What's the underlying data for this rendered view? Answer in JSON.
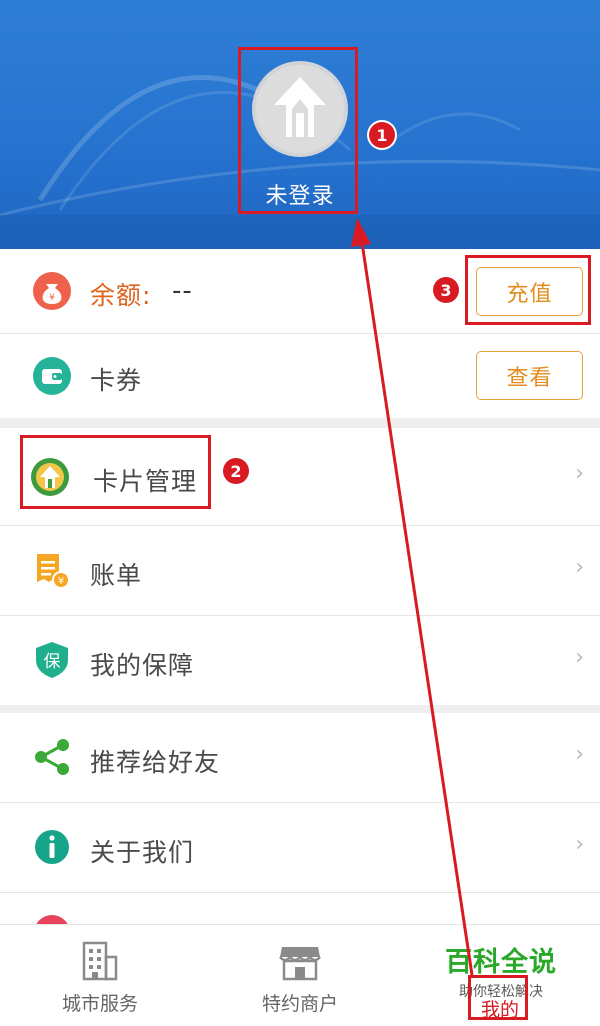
{
  "header": {
    "login_status": "未登录"
  },
  "balance": {
    "label": "余额:",
    "value": "--",
    "recharge_button": "充值"
  },
  "coupon": {
    "label": "卡券",
    "view_button": "查看"
  },
  "menu": {
    "card_management": "卡片管理",
    "bill": "账单",
    "my_protection": "我的保障",
    "recommend": "推荐给好友",
    "about_us": "关于我们"
  },
  "bottom_nav": {
    "items": [
      {
        "label": "城市服务",
        "icon": "building-icon"
      },
      {
        "label": "特约商户",
        "icon": "store-icon"
      },
      {
        "label": "我的",
        "icon": "profile-icon"
      }
    ]
  },
  "annotations": {
    "step1": "1",
    "step2": "2",
    "step3": "3"
  },
  "watermark": {
    "title": "百科全说",
    "subtitle": "助你轻松解决"
  },
  "colors": {
    "header_blue": "#2573cf",
    "accent_orange": "#e28d1d",
    "annotation_red": "#d81b22",
    "watermark_green": "#2aa82a"
  }
}
